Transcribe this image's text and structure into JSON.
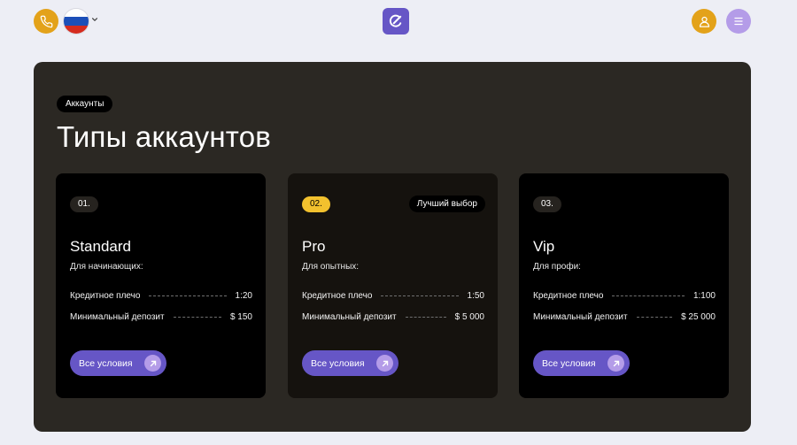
{
  "header": {
    "phone_icon": "phone-icon",
    "language_flag": "russia-flag",
    "logo_icon": "logo-icon",
    "user_icon": "user-icon",
    "menu_icon": "menu-icon"
  },
  "colors": {
    "accent_orange": "#e3a21a",
    "brand_purple": "#6656c6",
    "lilac": "#b49ce8",
    "badge_yellow": "#f2c12e",
    "section_bg": "#2b2823",
    "page_bg": "#edeef5"
  },
  "section": {
    "tag": "Аккаунты",
    "title": "Типы аккаунтов"
  },
  "cards": [
    {
      "number": "01.",
      "name": "Standard",
      "subtitle": "Для начинающих:",
      "rows": [
        {
          "label": "Кредитное плечо",
          "value": "1:20"
        },
        {
          "label": "Минимальный депозит",
          "value": "$ 150"
        }
      ],
      "button": "Все условия"
    },
    {
      "number": "02.",
      "badge": "Лучший выбор",
      "name": "Pro",
      "subtitle": "Для опытных:",
      "rows": [
        {
          "label": "Кредитное плечо",
          "value": "1:50"
        },
        {
          "label": "Минимальный депозит",
          "value": "$ 5 000"
        }
      ],
      "button": "Все условия"
    },
    {
      "number": "03.",
      "name": "Vip",
      "subtitle": "Для профи:",
      "rows": [
        {
          "label": "Кредитное плечо",
          "value": "1:100"
        },
        {
          "label": "Минимальный депозит",
          "value": "$ 25 000"
        }
      ],
      "button": "Все условия"
    }
  ]
}
